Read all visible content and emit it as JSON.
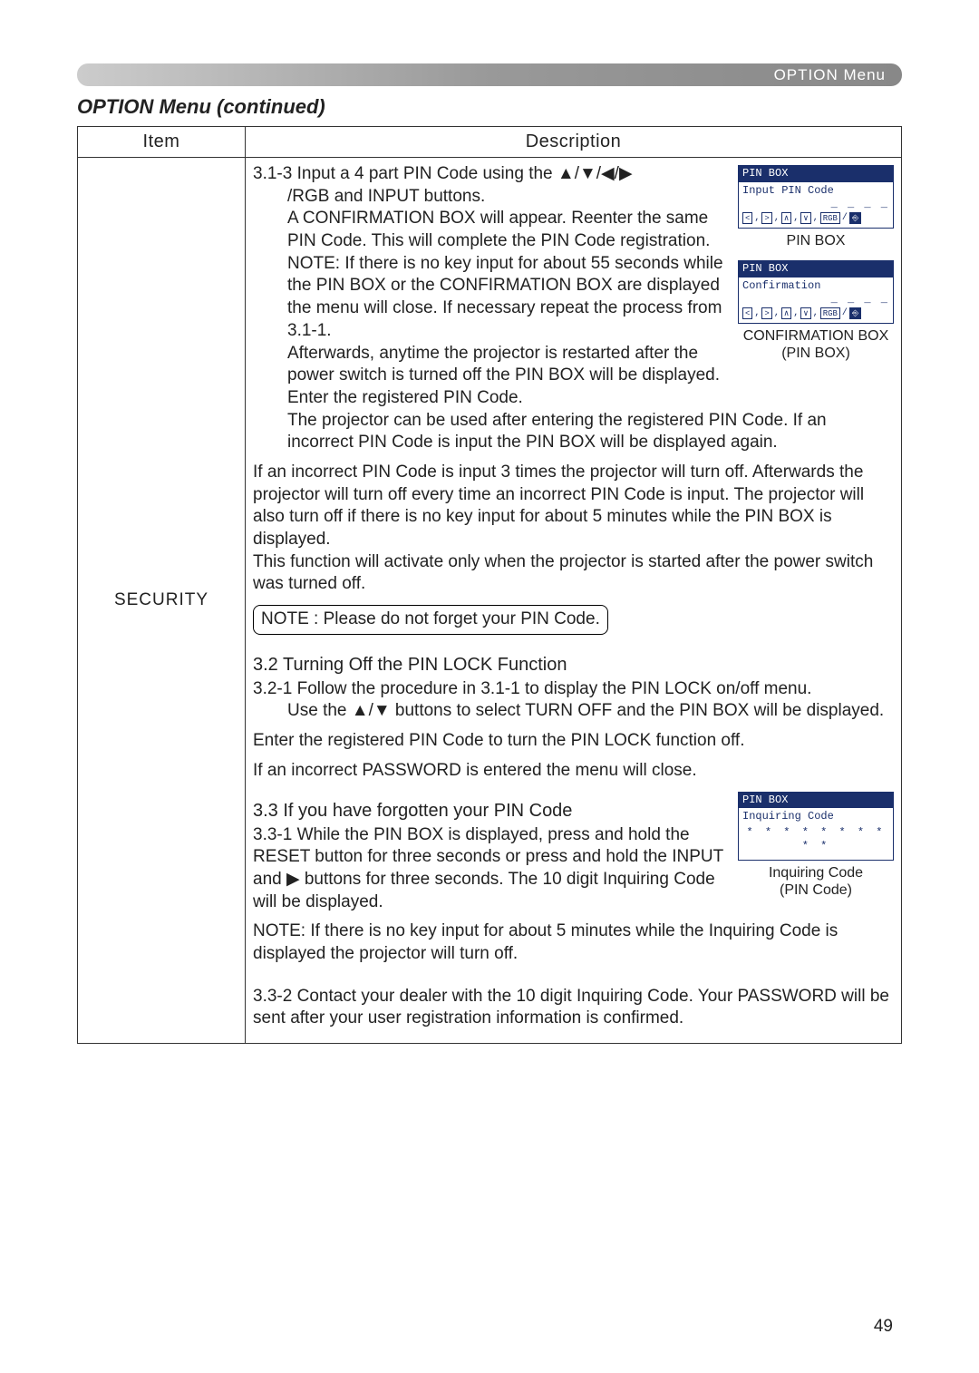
{
  "header": {
    "label": "OPTION Menu"
  },
  "title": "OPTION Menu (continued)",
  "table": {
    "headers": {
      "item": "Item",
      "desc": "Description"
    },
    "item_label": "SECURITY",
    "sec313": {
      "lead": "3.1-3  ",
      "line1": "Input a 4 part PIN Code using the ▲/▼/◀/▶",
      "line2": "/RGB and INPUT buttons.",
      "line3": "A CONFIRMATION BOX will appear. Reenter the same PIN Code. This will complete the PIN Code registration.",
      "note1": "NOTE: If there is no key input for about 55 seconds while the PIN BOX or the CONFIRMATION BOX are displayed the menu will close. If necessary repeat the process from 3.1-1.",
      "after1": "Afterwards, anytime the projector is restarted after the power switch is turned off the PIN BOX will be displayed. Enter the registered PIN Code.",
      "after2": "The projector can be used after entering the registered PIN Code. If an incorrect PIN Code is input the PIN BOX will be displayed again.",
      "after3": "If an incorrect PIN Code is input 3 times the projector will turn off. Afterwards the projector will turn off every time an incorrect PIN Code is input. The projector will also turn off if there is no key input for about 5 minutes while the PIN BOX is displayed.",
      "after4": "This function will activate only when the projector is started after the power switch was turned off.",
      "notebox": "NOTE : Please do not forget your PIN Code."
    },
    "sec32": {
      "head": "3.2 Turning Off the PIN LOCK Function",
      "lead": "3.2-1 ",
      "line1": "Follow the procedure in 3.1-1 to display the PIN LOCK on/off menu. Use the ▲/▼ buttons to select TURN OFF and the PIN BOX will be displayed.",
      "line2": "Enter the registered PIN Code to turn the PIN LOCK function off.",
      "line3": "If an incorrect PASSWORD is entered the  menu will close."
    },
    "sec33": {
      "head": "3.3 If you have forgotten your PIN Code",
      "lead": "3.3-1 ",
      "line1": "While the PIN BOX is displayed, press and hold the RESET button for three seconds or press and hold the INPUT and ▶ buttons for three seconds. The 10 digit Inquiring Code will be displayed.",
      "note": "NOTE: If there is no key input for about 5 minutes while the Inquiring Code is displayed the projector will turn off.",
      "lead2": "3.3-2 ",
      "line2": "Contact your dealer with the 10 digit Inquiring Code. Your PASSWORD will be sent after your user registration information is confirmed."
    }
  },
  "dialogs": {
    "pinbox": {
      "title": "PIN BOX",
      "sub": "Input PIN Code",
      "dashes": "_ _ _ _",
      "row": {
        "a": "<",
        "b": ">",
        "c": "∧",
        "d": "∨",
        "e": "RGB",
        "f": "⎆",
        "sep": ",",
        "slash": "/"
      },
      "caption": "PIN BOX"
    },
    "confirm": {
      "title": "PIN BOX",
      "sub": "Confirmation",
      "caption1": "CONFIRMATION BOX",
      "caption2": "(PIN BOX)"
    },
    "inquiring": {
      "title": "PIN BOX",
      "sub": "Inquiring Code",
      "stars": "* *  * * * *  * * * *",
      "caption1": "Inquiring Code",
      "caption2": "(PIN Code)"
    }
  },
  "page_number": "49"
}
